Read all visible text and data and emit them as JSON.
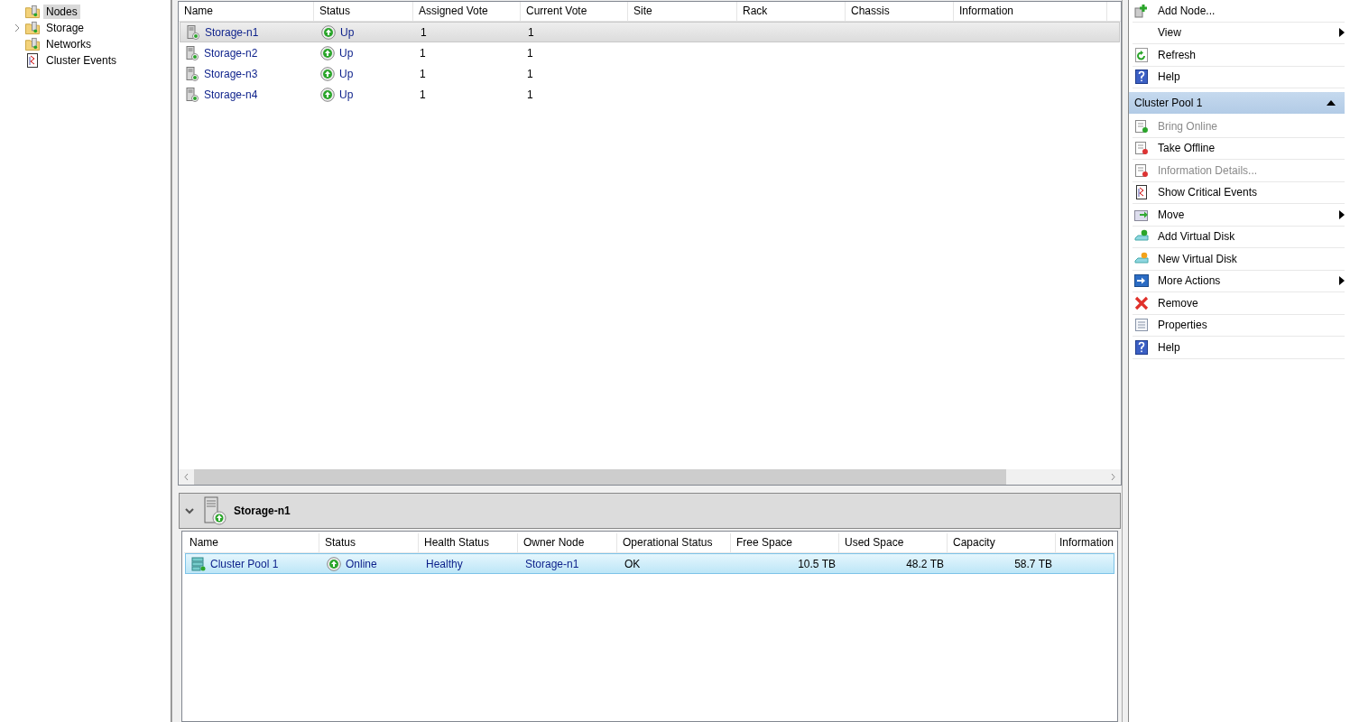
{
  "tree": {
    "items": [
      {
        "label": "Nodes",
        "selected": true,
        "expandable": false
      },
      {
        "label": "Storage",
        "selected": false,
        "expandable": true
      },
      {
        "label": "Networks",
        "selected": false,
        "expandable": false
      },
      {
        "label": "Cluster Events",
        "selected": false,
        "expandable": false
      }
    ]
  },
  "nodes_table": {
    "columns": [
      "Name",
      "Status",
      "Assigned Vote",
      "Current Vote",
      "Site",
      "Rack",
      "Chassis",
      "Information"
    ],
    "rows": [
      {
        "name": "Storage-n1",
        "status": "Up",
        "assigned_vote": "1",
        "current_vote": "1",
        "selected": true
      },
      {
        "name": "Storage-n2",
        "status": "Up",
        "assigned_vote": "1",
        "current_vote": "1",
        "selected": false
      },
      {
        "name": "Storage-n3",
        "status": "Up",
        "assigned_vote": "1",
        "current_vote": "1",
        "selected": false
      },
      {
        "name": "Storage-n4",
        "status": "Up",
        "assigned_vote": "1",
        "current_vote": "1",
        "selected": false
      }
    ]
  },
  "details": {
    "title": "Storage-n1",
    "expanded": true,
    "columns": [
      "Name",
      "Status",
      "Health Status",
      "Owner Node",
      "Operational Status",
      "Free Space",
      "Used Space",
      "Capacity",
      "Information"
    ],
    "rows": [
      {
        "name": "Cluster Pool 1",
        "status": "Online",
        "health_status": "Healthy",
        "owner_node": "Storage-n1",
        "operational_status": "OK",
        "free_space": "10.5 TB",
        "used_space": "48.2 TB",
        "capacity": "58.7 TB",
        "selected": true
      }
    ]
  },
  "actions": {
    "items": [
      {
        "label": "Add Node...",
        "disabled": false,
        "submenu": false
      },
      {
        "label": "View",
        "disabled": false,
        "submenu": true
      },
      {
        "label": "Refresh",
        "disabled": false,
        "submenu": false
      },
      {
        "label": "Help",
        "disabled": false,
        "submenu": false
      }
    ],
    "section": {
      "title": "Cluster Pool 1",
      "expanded": true,
      "items": [
        {
          "label": "Bring Online",
          "disabled": true,
          "submenu": false
        },
        {
          "label": "Take Offline",
          "disabled": false,
          "submenu": false
        },
        {
          "label": "Information Details...",
          "disabled": true,
          "submenu": false
        },
        {
          "label": "Show Critical Events",
          "disabled": false,
          "submenu": false
        },
        {
          "label": "Move",
          "disabled": false,
          "submenu": true
        },
        {
          "label": "Add Virtual Disk",
          "disabled": false,
          "submenu": false
        },
        {
          "label": "New Virtual Disk",
          "disabled": false,
          "submenu": false
        },
        {
          "label": "More Actions",
          "disabled": false,
          "submenu": true
        },
        {
          "label": "Remove",
          "disabled": false,
          "submenu": false
        },
        {
          "label": "Properties",
          "disabled": false,
          "submenu": false
        },
        {
          "label": "Help",
          "disabled": false,
          "submenu": false
        }
      ]
    }
  }
}
